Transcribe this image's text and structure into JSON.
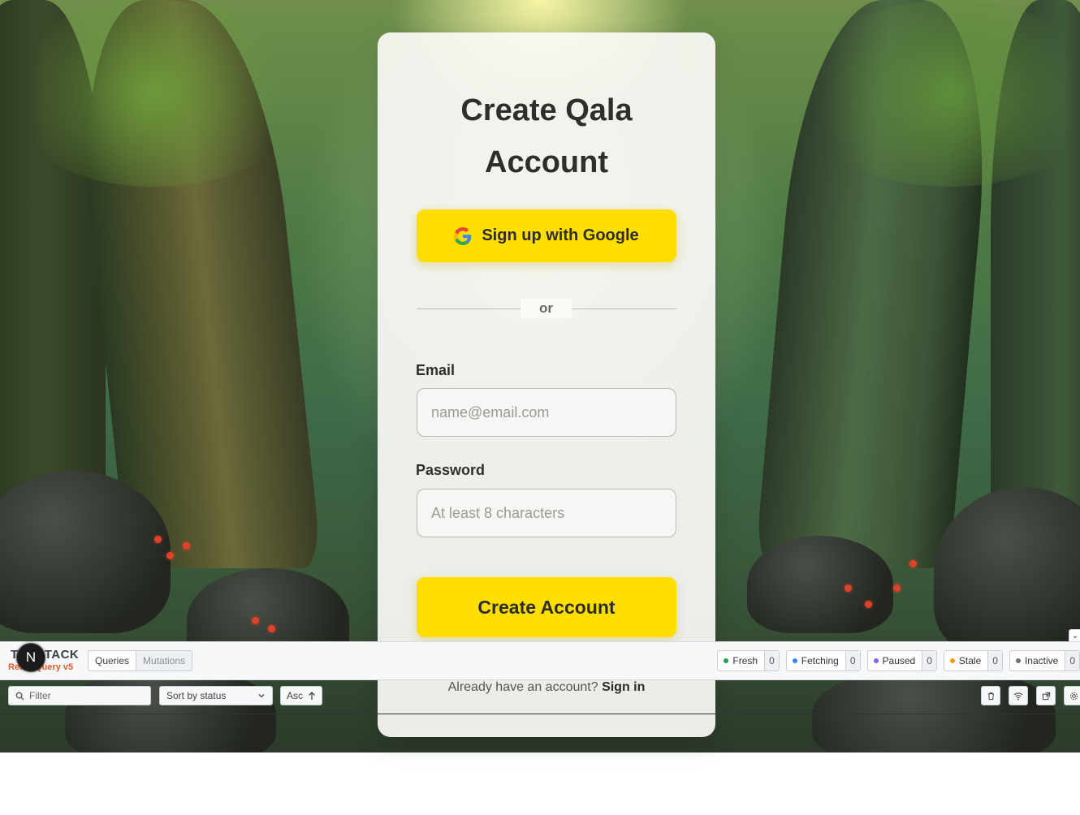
{
  "card": {
    "title_line1": "Create Qala",
    "title_line2": "Account",
    "google_button": "Sign up with Google",
    "divider_text": "or",
    "email_label": "Email",
    "email_placeholder": "name@email.com",
    "password_label": "Password",
    "password_placeholder": "At least 8 characters",
    "create_button": "Create Account",
    "signin_prompt": "Already have an account?",
    "signin_link": "Sign in"
  },
  "devtools": {
    "logo_top": "TANSTACK",
    "logo_bottom": "React Query v5",
    "n_badge": "N",
    "tabs": [
      "Queries",
      "Mutations"
    ],
    "statuses": [
      {
        "label": "Fresh",
        "count": "0",
        "color": "#16a34a"
      },
      {
        "label": "Fetching",
        "count": "0",
        "color": "#3b82f6"
      },
      {
        "label": "Paused",
        "count": "0",
        "color": "#8b5cf6"
      },
      {
        "label": "Stale",
        "count": "0",
        "color": "#f59e0b"
      },
      {
        "label": "Inactive",
        "count": "0",
        "color": "#6b7280"
      }
    ],
    "filter_placeholder": "Filter",
    "sort_value": "Sort by status",
    "order_value": "Asc",
    "tool_icons": [
      "trash-icon",
      "wifi-icon",
      "popout-icon",
      "gear-icon"
    ]
  },
  "colors": {
    "accent_yellow": "#ffde00",
    "card_bg": "#fafaf6"
  }
}
